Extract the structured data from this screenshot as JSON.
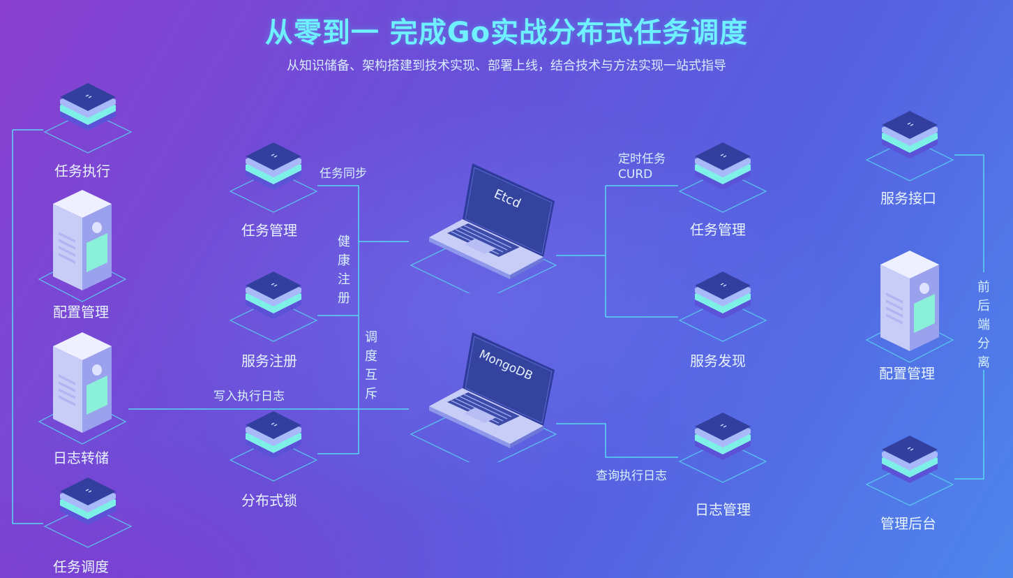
{
  "title": "从零到一 完成Go实战分布式任务调度",
  "subtitle": "从知识储备、架构搭建到技术实现、部署上线，结合技术与方法实现一站式指导",
  "colors": {
    "line": "#59d8f0",
    "title": "#6ff0ff",
    "chip_top": "#323f9e",
    "laptop_screen": "#2e3b9a"
  },
  "nodes": {
    "left_task_exec": "任务执行",
    "left_config": "配置管理",
    "left_log_dump": "日志转储",
    "left_task_sched": "任务调度",
    "mid_task_mgmt": "任务管理",
    "mid_service_reg": "服务注册",
    "mid_dist_lock": "分布式锁",
    "etcd": "Etcd",
    "mongodb": "MongoDB",
    "right_task_mgmt": "任务管理",
    "right_service_disc": "服务发现",
    "right_log_mgmt": "日志管理",
    "far_service_api": "服务接口",
    "far_config": "配置管理",
    "far_admin": "管理后台"
  },
  "edges": {
    "task_sync": "任务同步",
    "health_reg": "健康注册",
    "sched_mutex": "调度互斥",
    "write_log": "写入执行日志",
    "cron_line1": "定时任务",
    "cron_line2": "CURD",
    "query_log": "查询执行日志",
    "frontend_backend": "前后端分离"
  }
}
